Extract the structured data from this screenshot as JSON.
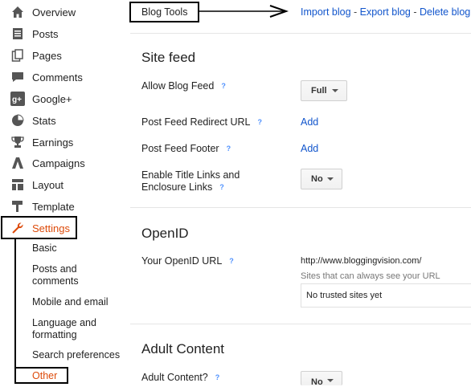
{
  "sidebar": {
    "items": [
      {
        "label": "Overview",
        "icon": "home-icon"
      },
      {
        "label": "Posts",
        "icon": "posts-icon"
      },
      {
        "label": "Pages",
        "icon": "pages-icon"
      },
      {
        "label": "Comments",
        "icon": "comments-icon"
      },
      {
        "label": "Google+",
        "icon": "google-plus-icon"
      },
      {
        "label": "Stats",
        "icon": "stats-icon"
      },
      {
        "label": "Earnings",
        "icon": "trophy-icon"
      },
      {
        "label": "Campaigns",
        "icon": "campaigns-icon"
      },
      {
        "label": "Layout",
        "icon": "layout-icon"
      },
      {
        "label": "Template",
        "icon": "template-icon"
      },
      {
        "label": "Settings",
        "icon": "wrench-icon"
      }
    ],
    "sub_items": [
      {
        "label": "Basic"
      },
      {
        "label": "Posts and comments"
      },
      {
        "label": "Mobile and email"
      },
      {
        "label": "Language and formatting"
      },
      {
        "label": "Search preferences"
      },
      {
        "label": "Other"
      }
    ],
    "active_color": "#dd4b0b"
  },
  "blog_tools": {
    "label": "Blog Tools",
    "import": "Import blog",
    "export": "Export blog",
    "delete": "Delete blog",
    "separator": " - "
  },
  "site_feed": {
    "title": "Site feed",
    "allow_blog_feed": {
      "label": "Allow Blog Feed",
      "value": "Full"
    },
    "redirect": {
      "label": "Post Feed Redirect URL",
      "action": "Add"
    },
    "footer": {
      "label": "Post Feed Footer",
      "action": "Add"
    },
    "title_links": {
      "label": "Enable Title Links and Enclosure Links",
      "value": "No"
    },
    "help": "?"
  },
  "openid": {
    "title": "OpenID",
    "label": "Your OpenID URL",
    "url": "http://www.bloggingvision.com/",
    "hint": "Sites that can always see your URL",
    "trusted": "No trusted sites yet"
  },
  "adult": {
    "title": "Adult Content",
    "label": "Adult Content?",
    "value": "No"
  },
  "colors": {
    "link": "#1155cc",
    "help": "#4d90fe"
  }
}
